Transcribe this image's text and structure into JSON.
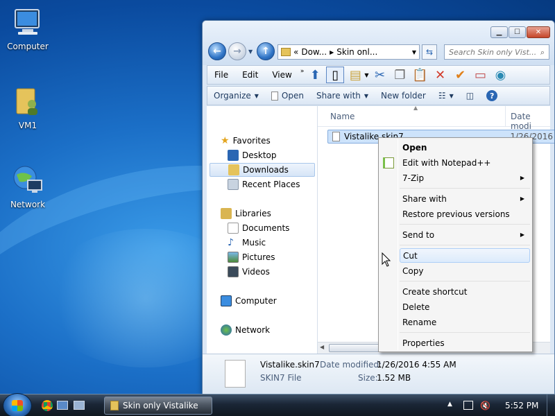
{
  "desktop": {
    "icons": [
      {
        "label": "Computer"
      },
      {
        "label": "VM1"
      },
      {
        "label": "Network"
      }
    ]
  },
  "window": {
    "address": {
      "crumb1": "Dow...",
      "crumb2": "Skin onl...",
      "prefix": "«"
    },
    "search_placeholder": "Search Skin only Vist...",
    "menu": [
      "File",
      "Edit",
      "View"
    ],
    "commands": {
      "organize": "Organize",
      "open": "Open",
      "share_with": "Share with",
      "new_folder": "New folder"
    },
    "nav": {
      "favorites": "Favorites",
      "desktop": "Desktop",
      "downloads": "Downloads",
      "recent": "Recent Places",
      "libraries": "Libraries",
      "documents": "Documents",
      "music": "Music",
      "pictures": "Pictures",
      "videos": "Videos",
      "computer": "Computer",
      "network": "Network"
    },
    "columns": {
      "name": "Name",
      "date": "Date modi"
    },
    "file": {
      "name": "Vistalike.skin7",
      "date": "1/26/2016"
    },
    "details": {
      "filename": "Vistalike.skin7",
      "type": "SKIN7 File",
      "date_label": "Date modified:",
      "date_value": "1/26/2016 4:55 AM",
      "size_label": "Size:",
      "size_value": "1.52 MB"
    }
  },
  "context_menu": {
    "open": "Open",
    "edit_notepad": "Edit with Notepad++",
    "zip": "7-Zip",
    "share_with": "Share with",
    "restore": "Restore previous versions",
    "send_to": "Send to",
    "cut": "Cut",
    "copy": "Copy",
    "create_shortcut": "Create shortcut",
    "delete": "Delete",
    "rename": "Rename",
    "properties": "Properties"
  },
  "taskbar": {
    "window_button": "Skin only Vistalike",
    "clock": "5:52 PM"
  }
}
